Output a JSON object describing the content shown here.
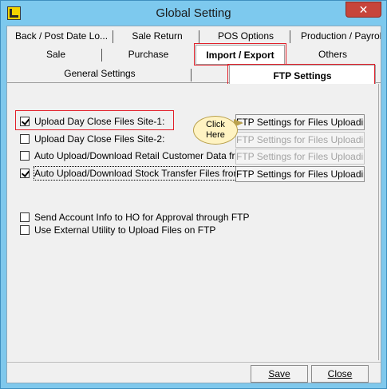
{
  "window": {
    "title": "Global Setting",
    "close_glyph": "✕"
  },
  "tabs_row1": [
    {
      "label": "Back / Post Date Lo..."
    },
    {
      "label": "Sale Return"
    },
    {
      "label": "POS Options"
    },
    {
      "label": "Production / Payrol"
    }
  ],
  "tabs_row2": [
    {
      "label": "Sale"
    },
    {
      "label": "Purchase"
    },
    {
      "label": "Import / Export",
      "active": true
    },
    {
      "label": "Others"
    }
  ],
  "subtabs": [
    {
      "label": "General Settings"
    },
    {
      "label": "FTP Settings",
      "active": true
    }
  ],
  "options": [
    {
      "label": "Upload Day Close Files Site-1:",
      "checked": true
    },
    {
      "label": "Upload Day Close Files Site-2:",
      "checked": false
    },
    {
      "label": "Auto Upload/Download Retail Customer Data from:",
      "checked": false
    },
    {
      "label": "Auto Upload/Download Stock Transfer Files from:",
      "checked": true
    },
    {
      "label": "Send Account Info to HO for Approval through FTP",
      "checked": false
    },
    {
      "label": "Use External Utility to Upload Files on FTP",
      "checked": false
    }
  ],
  "ftp_buttons": [
    {
      "label": "FTP Settings for Files Uploading",
      "enabled": true
    },
    {
      "label": "FTP Settings for Files Uploading",
      "enabled": false
    },
    {
      "label": "FTP Settings for Files Uploading",
      "enabled": false
    },
    {
      "label": "FTP Settings for Files Uploading",
      "enabled": true
    }
  ],
  "callout": {
    "line1": "Click",
    "line2": "Here"
  },
  "footer": {
    "save_label": "Save",
    "close_label": "Close"
  },
  "colors": {
    "highlight_frame": "#e2202a",
    "titlebar": "#7dc9ee",
    "close_button": "#c7453b",
    "callout_fill": "#fff3c2"
  }
}
